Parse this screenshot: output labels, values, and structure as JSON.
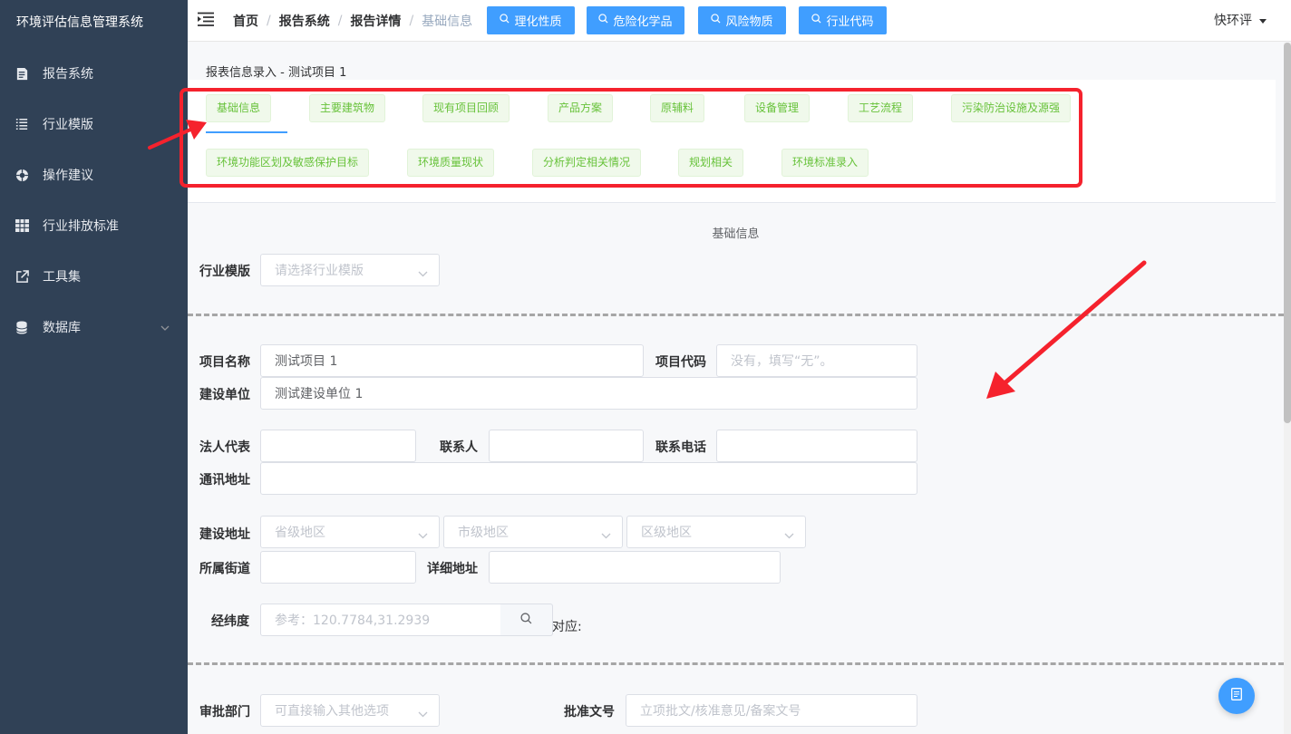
{
  "app": {
    "title": "环境评估信息管理系统"
  },
  "sidebar": {
    "items": [
      {
        "label": "报告系统",
        "icon": "report-icon"
      },
      {
        "label": "行业模版",
        "icon": "list-icon"
      },
      {
        "label": "操作建议",
        "icon": "aperture-icon"
      },
      {
        "label": "行业排放标准",
        "icon": "grid-icon"
      },
      {
        "label": "工具集",
        "icon": "external-link-icon"
      },
      {
        "label": "数据库",
        "icon": "database-icon"
      }
    ]
  },
  "header": {
    "breadcrumb": [
      "首页",
      "报告系统",
      "报告详情",
      "基础信息"
    ],
    "buttons": [
      "理化性质",
      "危险化学品",
      "风险物质",
      "行业代码"
    ],
    "user": "快环评"
  },
  "tabs_section": {
    "title": "报表信息录入 - 测试项目 1",
    "row1": [
      "基础信息",
      "主要建筑物",
      "现有项目回顾",
      "产品方案",
      "原辅料",
      "设备管理",
      "工艺流程",
      "污染防治设施及源强"
    ],
    "row2": [
      "环境功能区划及敏感保护目标",
      "环境质量现状",
      "分析判定相关情况",
      "规划相关",
      "环境标准录入"
    ]
  },
  "form": {
    "heading": "基础信息",
    "industry_template": {
      "label": "行业模版",
      "placeholder": "请选择行业模版"
    },
    "project_name": {
      "label": "项目名称",
      "value": "测试项目 1"
    },
    "project_code": {
      "label": "项目代码",
      "placeholder": "没有，填写“无”。"
    },
    "builder": {
      "label": "建设单位",
      "value": "测试建设单位 1"
    },
    "legal_rep": {
      "label": "法人代表",
      "value": ""
    },
    "contact": {
      "label": "联系人",
      "value": ""
    },
    "phone": {
      "label": "联系电话",
      "value": ""
    },
    "address": {
      "label": "通讯地址",
      "value": ""
    },
    "build_address": {
      "label": "建设地址",
      "province": "省级地区",
      "city": "市级地区",
      "district": "区级地区"
    },
    "street": {
      "label": "所属街道",
      "value": ""
    },
    "detail_address": {
      "label": "详细地址",
      "value": ""
    },
    "latlng": {
      "label": "经纬度",
      "placeholder": "参考：120.7784,31.2939",
      "corresponds": "对应:"
    },
    "approval_dept": {
      "label": "审批部门",
      "placeholder": "可直接输入其他选项"
    },
    "approval_doc": {
      "label": "批准文号",
      "placeholder": "立项批文/核准意见/备案文号"
    }
  },
  "colors": {
    "sidebar": "#304156",
    "primary": "#409eff",
    "tag_green": "#67c23a",
    "annotation_red": "#f5222d"
  }
}
